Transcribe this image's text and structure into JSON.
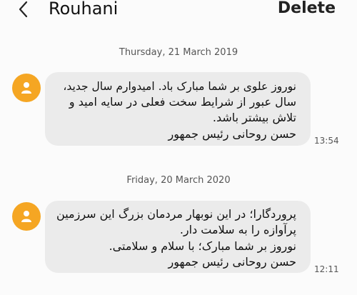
{
  "header": {
    "title": "Rouhani",
    "delete_label": "Delete",
    "back_icon": "chevron-left-icon"
  },
  "accent_color": "#f5a623",
  "messages": [
    {
      "date": "Thursday, 21 March 2019",
      "lines": [
        "نوروز علوی بر شما مبارک باد. امیدوارم سال جدید،",
        "سال عبور از شرایط سخت فعلی در سایه امید و",
        "تلاش بیشتر باشد.",
        "حسن روحانی رئیس جمهور"
      ],
      "time": "13:54"
    },
    {
      "date": "Friday, 20 March 2020",
      "lines": [
        "پروردگارا؛ در این نوبهار مردمان بزرگ این سرزمین",
        "پرآوازه را به سلامت دار.",
        "نوروز بر شما مبارک؛ با سلام و سلامتی.",
        "حسن روحانی رئیس جمهور"
      ],
      "time": "12:11"
    }
  ]
}
